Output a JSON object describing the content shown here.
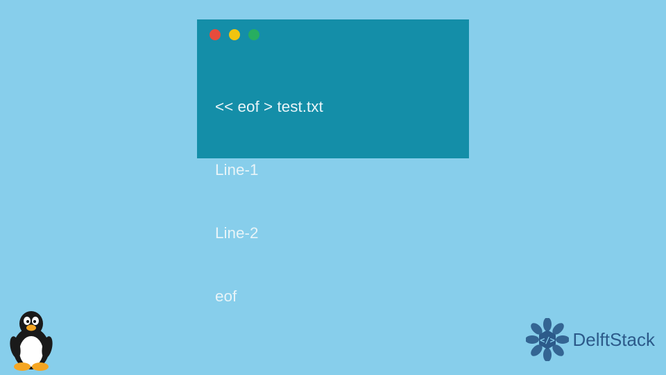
{
  "terminal": {
    "traffic_lights": [
      "red",
      "yellow",
      "green"
    ],
    "code_lines": [
      "<< eof > test.txt",
      "Line-1",
      "Line-2",
      "eof"
    ]
  },
  "brand": {
    "name": "DelftStack"
  },
  "icons": {
    "tux": "tux-penguin-icon",
    "brand_logo": "delftstack-logo-icon"
  }
}
